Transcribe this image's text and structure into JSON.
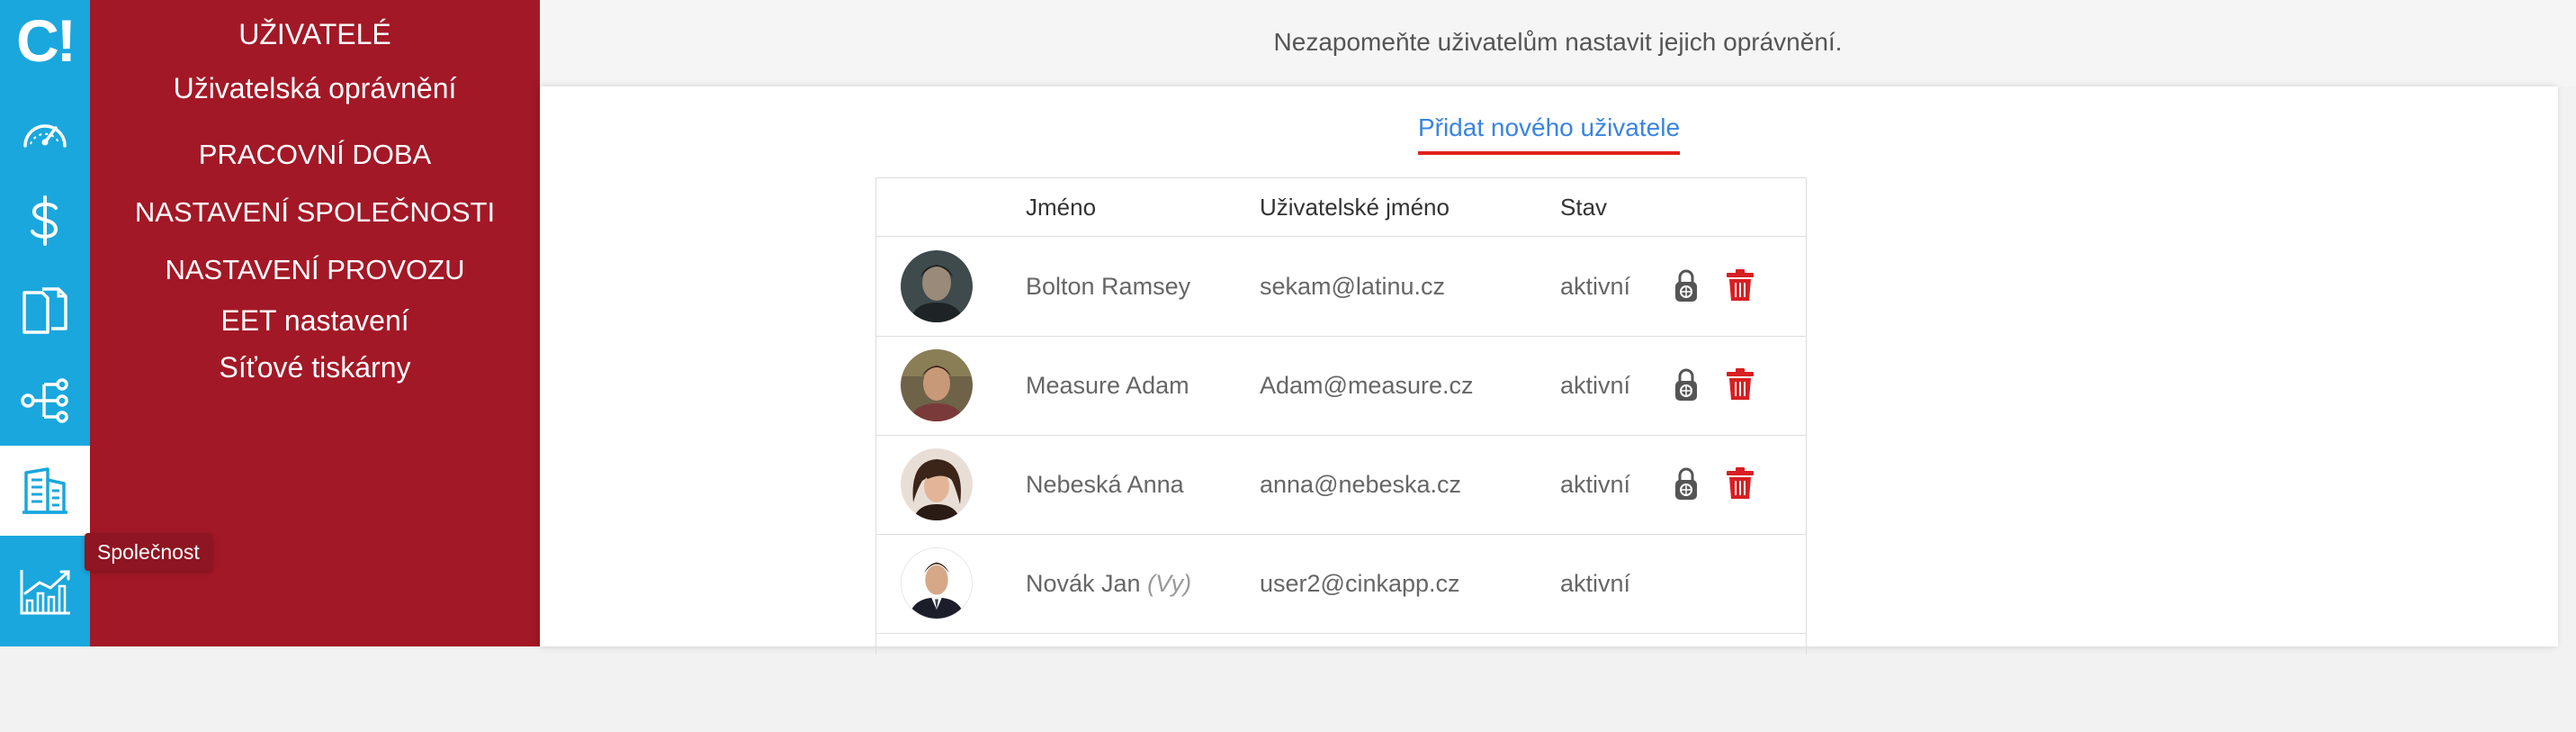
{
  "app": {
    "logo_text": "C!"
  },
  "rail": {
    "items": [
      {
        "icon": "speedometer-icon"
      },
      {
        "icon": "dollar-icon"
      },
      {
        "icon": "documents-icon"
      },
      {
        "icon": "network-icon"
      },
      {
        "icon": "building-icon",
        "active": true
      },
      {
        "icon": "chart-icon"
      }
    ]
  },
  "tooltip": {
    "label": "Společnost"
  },
  "submenu": {
    "items": [
      {
        "label": "UŽIVATELÉ"
      },
      {
        "label": "Uživatelská oprávnění"
      },
      {
        "label": "PRACOVNÍ DOBA"
      },
      {
        "label": "NASTAVENÍ SPOLEČNOSTI"
      },
      {
        "label": "NASTAVENÍ PROVOZU"
      },
      {
        "label": "EET nastavení"
      },
      {
        "label": "Síťové tiskárny"
      }
    ]
  },
  "header": {
    "message": "Nezapomeňte uživatelům nastavit jejich oprávnění."
  },
  "main": {
    "add_user_label": "Přidat nového uživatele",
    "columns": {
      "name": "Jméno",
      "username": "Uživatelské jméno",
      "status": "Stav"
    },
    "rows": [
      {
        "name": "Bolton Ramsey",
        "you": "",
        "username": "sekam@latinu.cz",
        "status": "aktivní"
      },
      {
        "name": "Measure Adam",
        "you": "",
        "username": "Adam@measure.cz",
        "status": "aktivní"
      },
      {
        "name": "Nebeská Anna",
        "you": "",
        "username": "anna@nebeska.cz",
        "status": "aktivní"
      },
      {
        "name": "Novák Jan",
        "you": "(Vy)",
        "username": "user2@cinkapp.cz",
        "status": "aktivní"
      }
    ]
  },
  "colors": {
    "rail": "#1aa7dd",
    "submenu": "#a31826",
    "link": "#3a84e0",
    "delete": "#d81f22",
    "underline": "#e0211c"
  }
}
